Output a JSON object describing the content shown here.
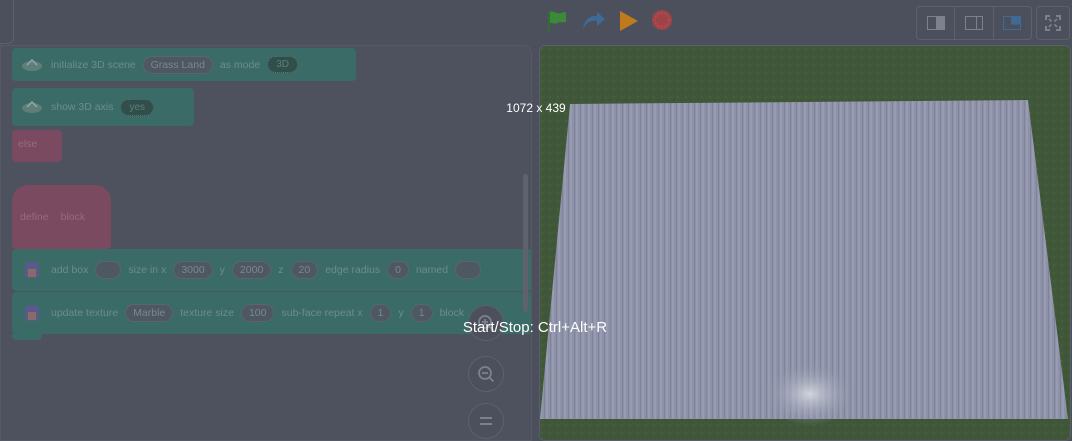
{
  "toolbar": {
    "green_flag_icon": "green-flag-icon",
    "turbo_icon": "turbo-icon",
    "start_icon": "play-icon",
    "stop_icon": "stop-icon",
    "layout_buttons": [
      "small-stage-icon",
      "normal-stage-icon",
      "large-stage-icon"
    ],
    "fullscreen_icon": "fullscreen-icon"
  },
  "code": {
    "block1": {
      "label": "initialize 3D scene",
      "scene": "Grass Land",
      "label2": "as mode",
      "mode": "3D"
    },
    "block2": {
      "label": "show 3D axis",
      "value": "yes"
    },
    "block3": {
      "label": "else"
    },
    "block4": {
      "define": "define",
      "name": "block"
    },
    "block5": {
      "label": "add box",
      "label2": "size in x",
      "x": "3000",
      "y_label": "y",
      "y": "2000",
      "z_label": "z",
      "z": "20",
      "edge_label": "edge radius",
      "edge": "0",
      "name_label": "named"
    },
    "block6": {
      "label": "update texture",
      "texture": "Marble",
      "size_label": "texture size",
      "size": "100",
      "repeat_label": "sub-face repeat x",
      "repeat_x": "1",
      "y_label": "y",
      "repeat_y": "1",
      "tail": "block"
    }
  },
  "zoom": {
    "zoom_in": "zoom-in-icon",
    "zoom_out": "zoom-out-icon",
    "reset": "zoom-reset-icon"
  },
  "overlay": {
    "size": "1072 x 439",
    "shortcut": "Start/Stop: Ctrl+Alt+R"
  },
  "colors": {
    "background": "#4c505c",
    "stage_grass": "#40573a",
    "floor": "#8d92a8",
    "extension_block": "#3b6b66",
    "custom_block": "#7a4a61",
    "flag_green": "#3a8a3a",
    "play_orange": "#c07a1e",
    "stop_red": "#a04348"
  }
}
